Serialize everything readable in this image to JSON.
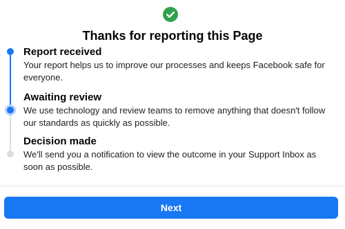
{
  "header": {
    "icon": "check-circle-icon",
    "title": "Thanks for reporting this Page"
  },
  "steps": [
    {
      "title": "Report received",
      "description": "Your report helps us to improve our processes and keeps Facebook safe for everyone.",
      "status": "done"
    },
    {
      "title": "Awaiting review",
      "description": "We use technology and review teams to remove anything that doesn't follow our standards as quickly as possible.",
      "status": "current"
    },
    {
      "title": "Decision made",
      "description": "We'll send you a notification to view the outcome in your Support Inbox as soon as possible.",
      "status": "pending"
    }
  ],
  "footer": {
    "next_label": "Next"
  },
  "colors": {
    "accent": "#1877f2",
    "success": "#42b72a",
    "inactive": "#dadde1"
  }
}
